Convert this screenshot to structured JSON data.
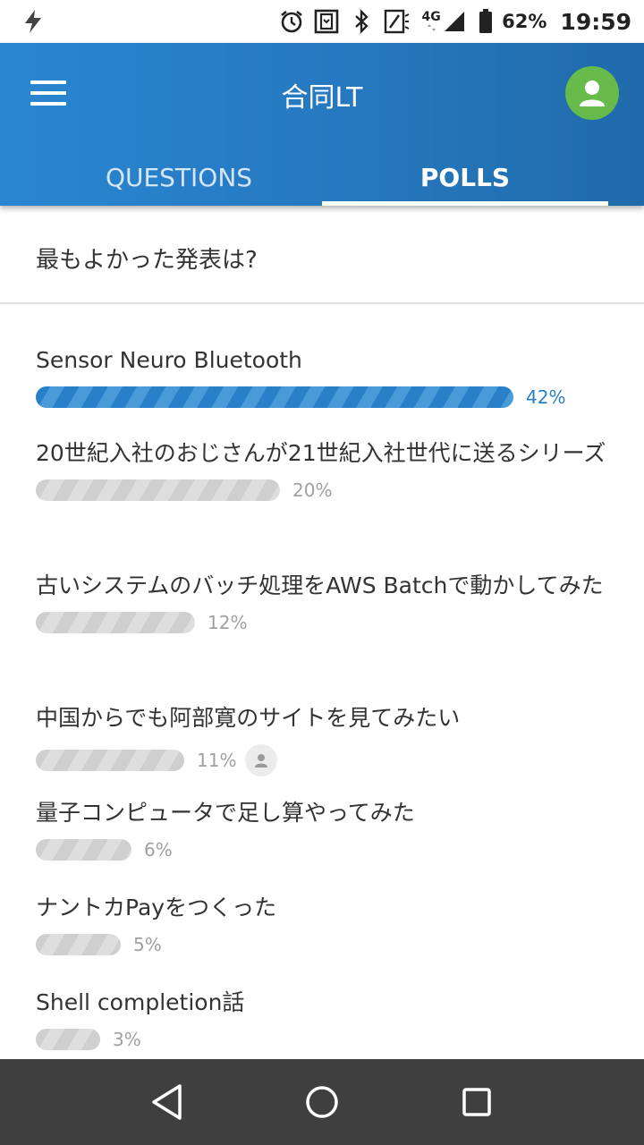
{
  "status_bar": {
    "network_type": "4G",
    "battery_percent": "62%",
    "time": "19:59",
    "icons": [
      "flash-icon",
      "alarm-icon",
      "vibrate-icon",
      "bluetooth-icon",
      "nfc-icon",
      "signal-icon",
      "battery-icon"
    ]
  },
  "app_bar": {
    "title": "合同LT",
    "menu_icon": "menu-icon",
    "avatar_icon": "person-icon",
    "avatar_color": "#66bb4a",
    "accent_color": "#2577bd"
  },
  "tabs": [
    {
      "label": "QUESTIONS",
      "active": false
    },
    {
      "label": "POLLS",
      "active": true
    }
  ],
  "poll": {
    "question": "最もよかった発表は?",
    "options": [
      {
        "label": "Sensor Neuro Bluetooth",
        "percent": 42,
        "percent_label": "42%",
        "leading": true,
        "voted": false
      },
      {
        "label": "20世紀入社のおじさんが21世紀入社世代に送るシリーズ",
        "percent": 20,
        "percent_label": "20%",
        "leading": false,
        "voted": false
      },
      {
        "label": "古いシステムのバッチ処理をAWS Batchで動かしてみた",
        "percent": 12,
        "percent_label": "12%",
        "leading": false,
        "voted": false
      },
      {
        "label": "中国からでも阿部寛のサイトを見てみたい",
        "percent": 11,
        "percent_label": "11%",
        "leading": false,
        "voted": true
      },
      {
        "label": "量子コンピュータで足し算やってみた",
        "percent": 6,
        "percent_label": "6%",
        "leading": false,
        "voted": false
      },
      {
        "label": "ナントカPayをつくった",
        "percent": 5,
        "percent_label": "5%",
        "leading": false,
        "voted": false
      },
      {
        "label": "Shell completion話",
        "percent": 3,
        "percent_label": "3%",
        "leading": false,
        "voted": false
      }
    ]
  },
  "nav_bar": {
    "buttons": [
      "back-icon",
      "home-icon",
      "recents-icon"
    ]
  }
}
